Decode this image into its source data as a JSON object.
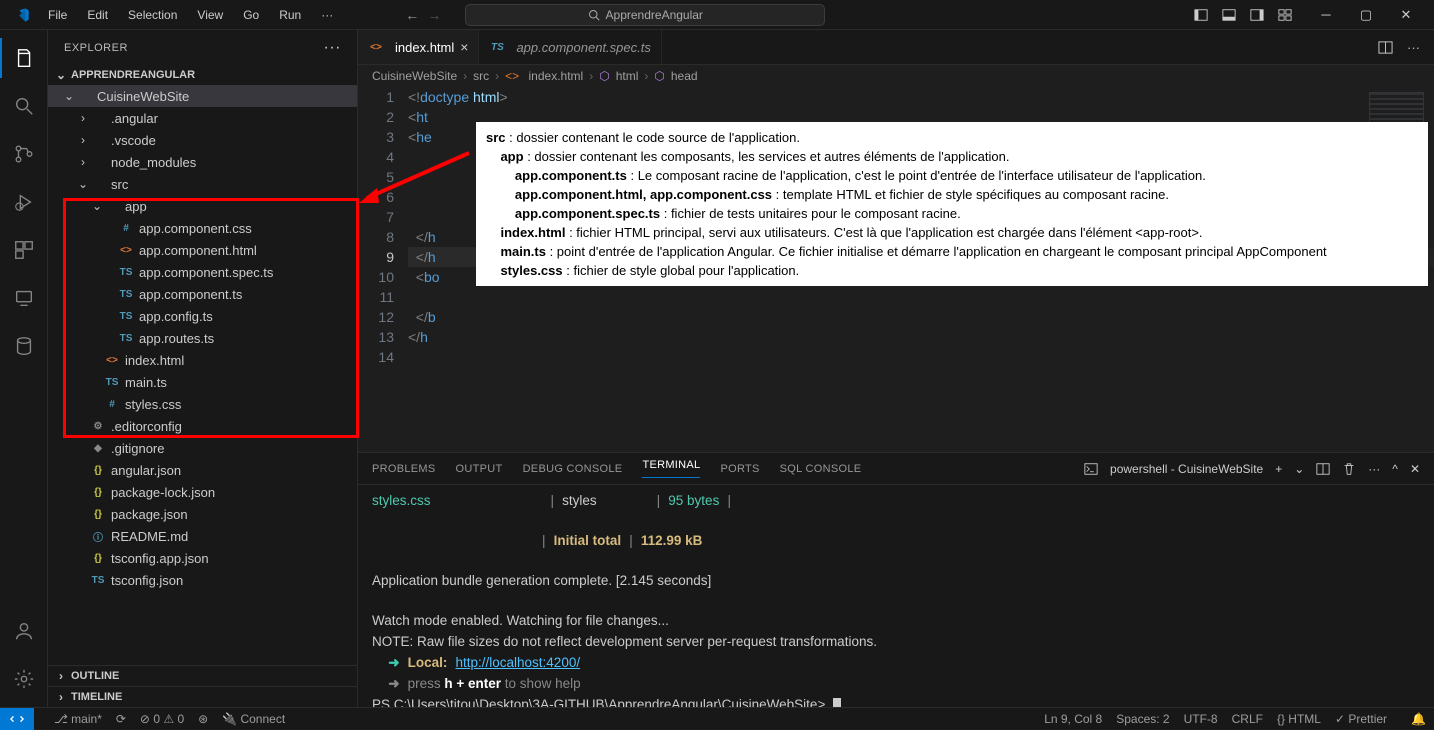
{
  "titlebar": {
    "menus": [
      "File",
      "Edit",
      "Selection",
      "View",
      "Go",
      "Run"
    ],
    "search_label": "ApprendreAngular"
  },
  "sidebar": {
    "title": "EXPLORER",
    "root": "APPRENDREANGULAR",
    "outline": "OUTLINE",
    "timeline": "TIMELINE",
    "tree": [
      {
        "depth": 0,
        "chev": "⌄",
        "icon": "",
        "name": "CuisineWebSite",
        "open": true
      },
      {
        "depth": 1,
        "chev": "›",
        "icon": "",
        "name": ".angular"
      },
      {
        "depth": 1,
        "chev": "›",
        "icon": "",
        "name": ".vscode"
      },
      {
        "depth": 1,
        "chev": "›",
        "icon": "",
        "name": "node_modules"
      },
      {
        "depth": 1,
        "chev": "⌄",
        "icon": "",
        "name": "src"
      },
      {
        "depth": 2,
        "chev": "⌄",
        "icon": "",
        "name": "app"
      },
      {
        "depth": 3,
        "chev": "",
        "icon": "#",
        "cls": "ic-css",
        "name": "app.component.css"
      },
      {
        "depth": 3,
        "chev": "",
        "icon": "<>",
        "cls": "ic-html",
        "name": "app.component.html"
      },
      {
        "depth": 3,
        "chev": "",
        "icon": "TS",
        "cls": "ic-ts",
        "name": "app.component.spec.ts"
      },
      {
        "depth": 3,
        "chev": "",
        "icon": "TS",
        "cls": "ic-ts",
        "name": "app.component.ts"
      },
      {
        "depth": 3,
        "chev": "",
        "icon": "TS",
        "cls": "ic-ts",
        "name": "app.config.ts"
      },
      {
        "depth": 3,
        "chev": "",
        "icon": "TS",
        "cls": "ic-ts",
        "name": "app.routes.ts"
      },
      {
        "depth": 2,
        "chev": "",
        "icon": "<>",
        "cls": "ic-html",
        "name": "index.html"
      },
      {
        "depth": 2,
        "chev": "",
        "icon": "TS",
        "cls": "ic-ts",
        "name": "main.ts"
      },
      {
        "depth": 2,
        "chev": "",
        "icon": "#",
        "cls": "ic-css",
        "name": "styles.css"
      },
      {
        "depth": 1,
        "chev": "",
        "icon": "⚙",
        "cls": "ic-cfg",
        "name": ".editorconfig"
      },
      {
        "depth": 1,
        "chev": "",
        "icon": "◆",
        "cls": "ic-cfg",
        "name": ".gitignore"
      },
      {
        "depth": 1,
        "chev": "",
        "icon": "{}",
        "cls": "ic-json",
        "name": "angular.json"
      },
      {
        "depth": 1,
        "chev": "",
        "icon": "{}",
        "cls": "ic-json",
        "name": "package-lock.json"
      },
      {
        "depth": 1,
        "chev": "",
        "icon": "{}",
        "cls": "ic-json",
        "name": "package.json"
      },
      {
        "depth": 1,
        "chev": "",
        "icon": "ⓘ",
        "cls": "ic-md",
        "name": "README.md"
      },
      {
        "depth": 1,
        "chev": "",
        "icon": "{}",
        "cls": "ic-json",
        "name": "tsconfig.app.json"
      },
      {
        "depth": 1,
        "chev": "",
        "icon": "TS",
        "cls": "ic-ts",
        "name": "tsconfig.json"
      }
    ]
  },
  "tabs": [
    {
      "icon": "<>",
      "icls": "ic-html",
      "label": "index.html",
      "active": true
    },
    {
      "icon": "TS",
      "icls": "ic-ts",
      "label": "app.component.spec.ts",
      "italic": true
    }
  ],
  "breadcrumb": [
    "CuisineWebSite",
    "src",
    "index.html",
    "html",
    "head"
  ],
  "editor": {
    "lines": [
      1,
      2,
      3,
      4,
      5,
      6,
      7,
      8,
      9,
      10,
      11,
      12,
      13,
      14
    ],
    "currentLine": 9
  },
  "code": {
    "l1": "<!doctype html>",
    "l2": "<ht",
    "l3": "<he",
    "l8": "  </h",
    "l9": "  </h",
    "l10": "  <bo",
    "l12": "  </b",
    "l13": "</h"
  },
  "panel": {
    "tabs": [
      "PROBLEMS",
      "OUTPUT",
      "DEBUG CONSOLE",
      "TERMINAL",
      "PORTS",
      "SQL CONSOLE"
    ],
    "active": "TERMINAL",
    "profile": "powershell - CuisineWebSite"
  },
  "terminal": {
    "row_file": "styles.css",
    "row_name": "styles",
    "row_size": "95 bytes",
    "total_label": "Initial total",
    "total_size": "112.99 kB",
    "line_complete": "Application bundle generation complete. [2.145 seconds]",
    "line_watch": "Watch mode enabled. Watching for file changes...",
    "line_note": "NOTE: Raw file sizes do not reflect development server per-request transformations.",
    "local_label": "Local:",
    "local_url": "http://localhost:4200/",
    "press_prefix": "press ",
    "press_key": "h + enter",
    "press_suffix": " to show help",
    "prompt": "PS C:\\Users\\titou\\Desktop\\3A-GITHUB\\ApprendreAngular\\CuisineWebSite>"
  },
  "status": {
    "branch": "main",
    "sync": "⟳",
    "errors": "0",
    "warnings": "0",
    "radio": "⊘",
    "connect": "Connect",
    "pos": "Ln 9, Col 8",
    "spaces": "Spaces: 2",
    "enc": "UTF-8",
    "eol": "CRLF",
    "lang": "{} HTML",
    "prettier": "✓ Prettier"
  },
  "annotation": {
    "src": "src",
    "src_t": " : dossier contenant le code source de l'application.",
    "app": "app",
    "app_t": " : dossier contenant les composants, les services et autres éléments de l'application.",
    "c1": "app.component.ts",
    "c1_t": " : Le composant racine de l'application, c'est le point d'entrée de l'interface utilisateur de l'application.",
    "c2": "app.component.html, app.component.css",
    "c2_t": " : template HTML et fichier de style spécifiques au composant racine.",
    "c3": "app.component.spec.ts",
    "c3_t": " : fichier de tests unitaires pour le composant racine.",
    "idx": "index.html",
    "idx_t": " : fichier HTML principal, servi aux utilisateurs. C'est là que l'application est chargée dans l'élément <app-root>.",
    "main": "main.ts",
    "main_t": " : point d'entrée de l'application Angular. Ce fichier initialise et démarre l'application en chargeant le composant    principal AppComponent",
    "sty": "styles.css",
    "sty_t": " : fichier de style global pour l'application."
  }
}
